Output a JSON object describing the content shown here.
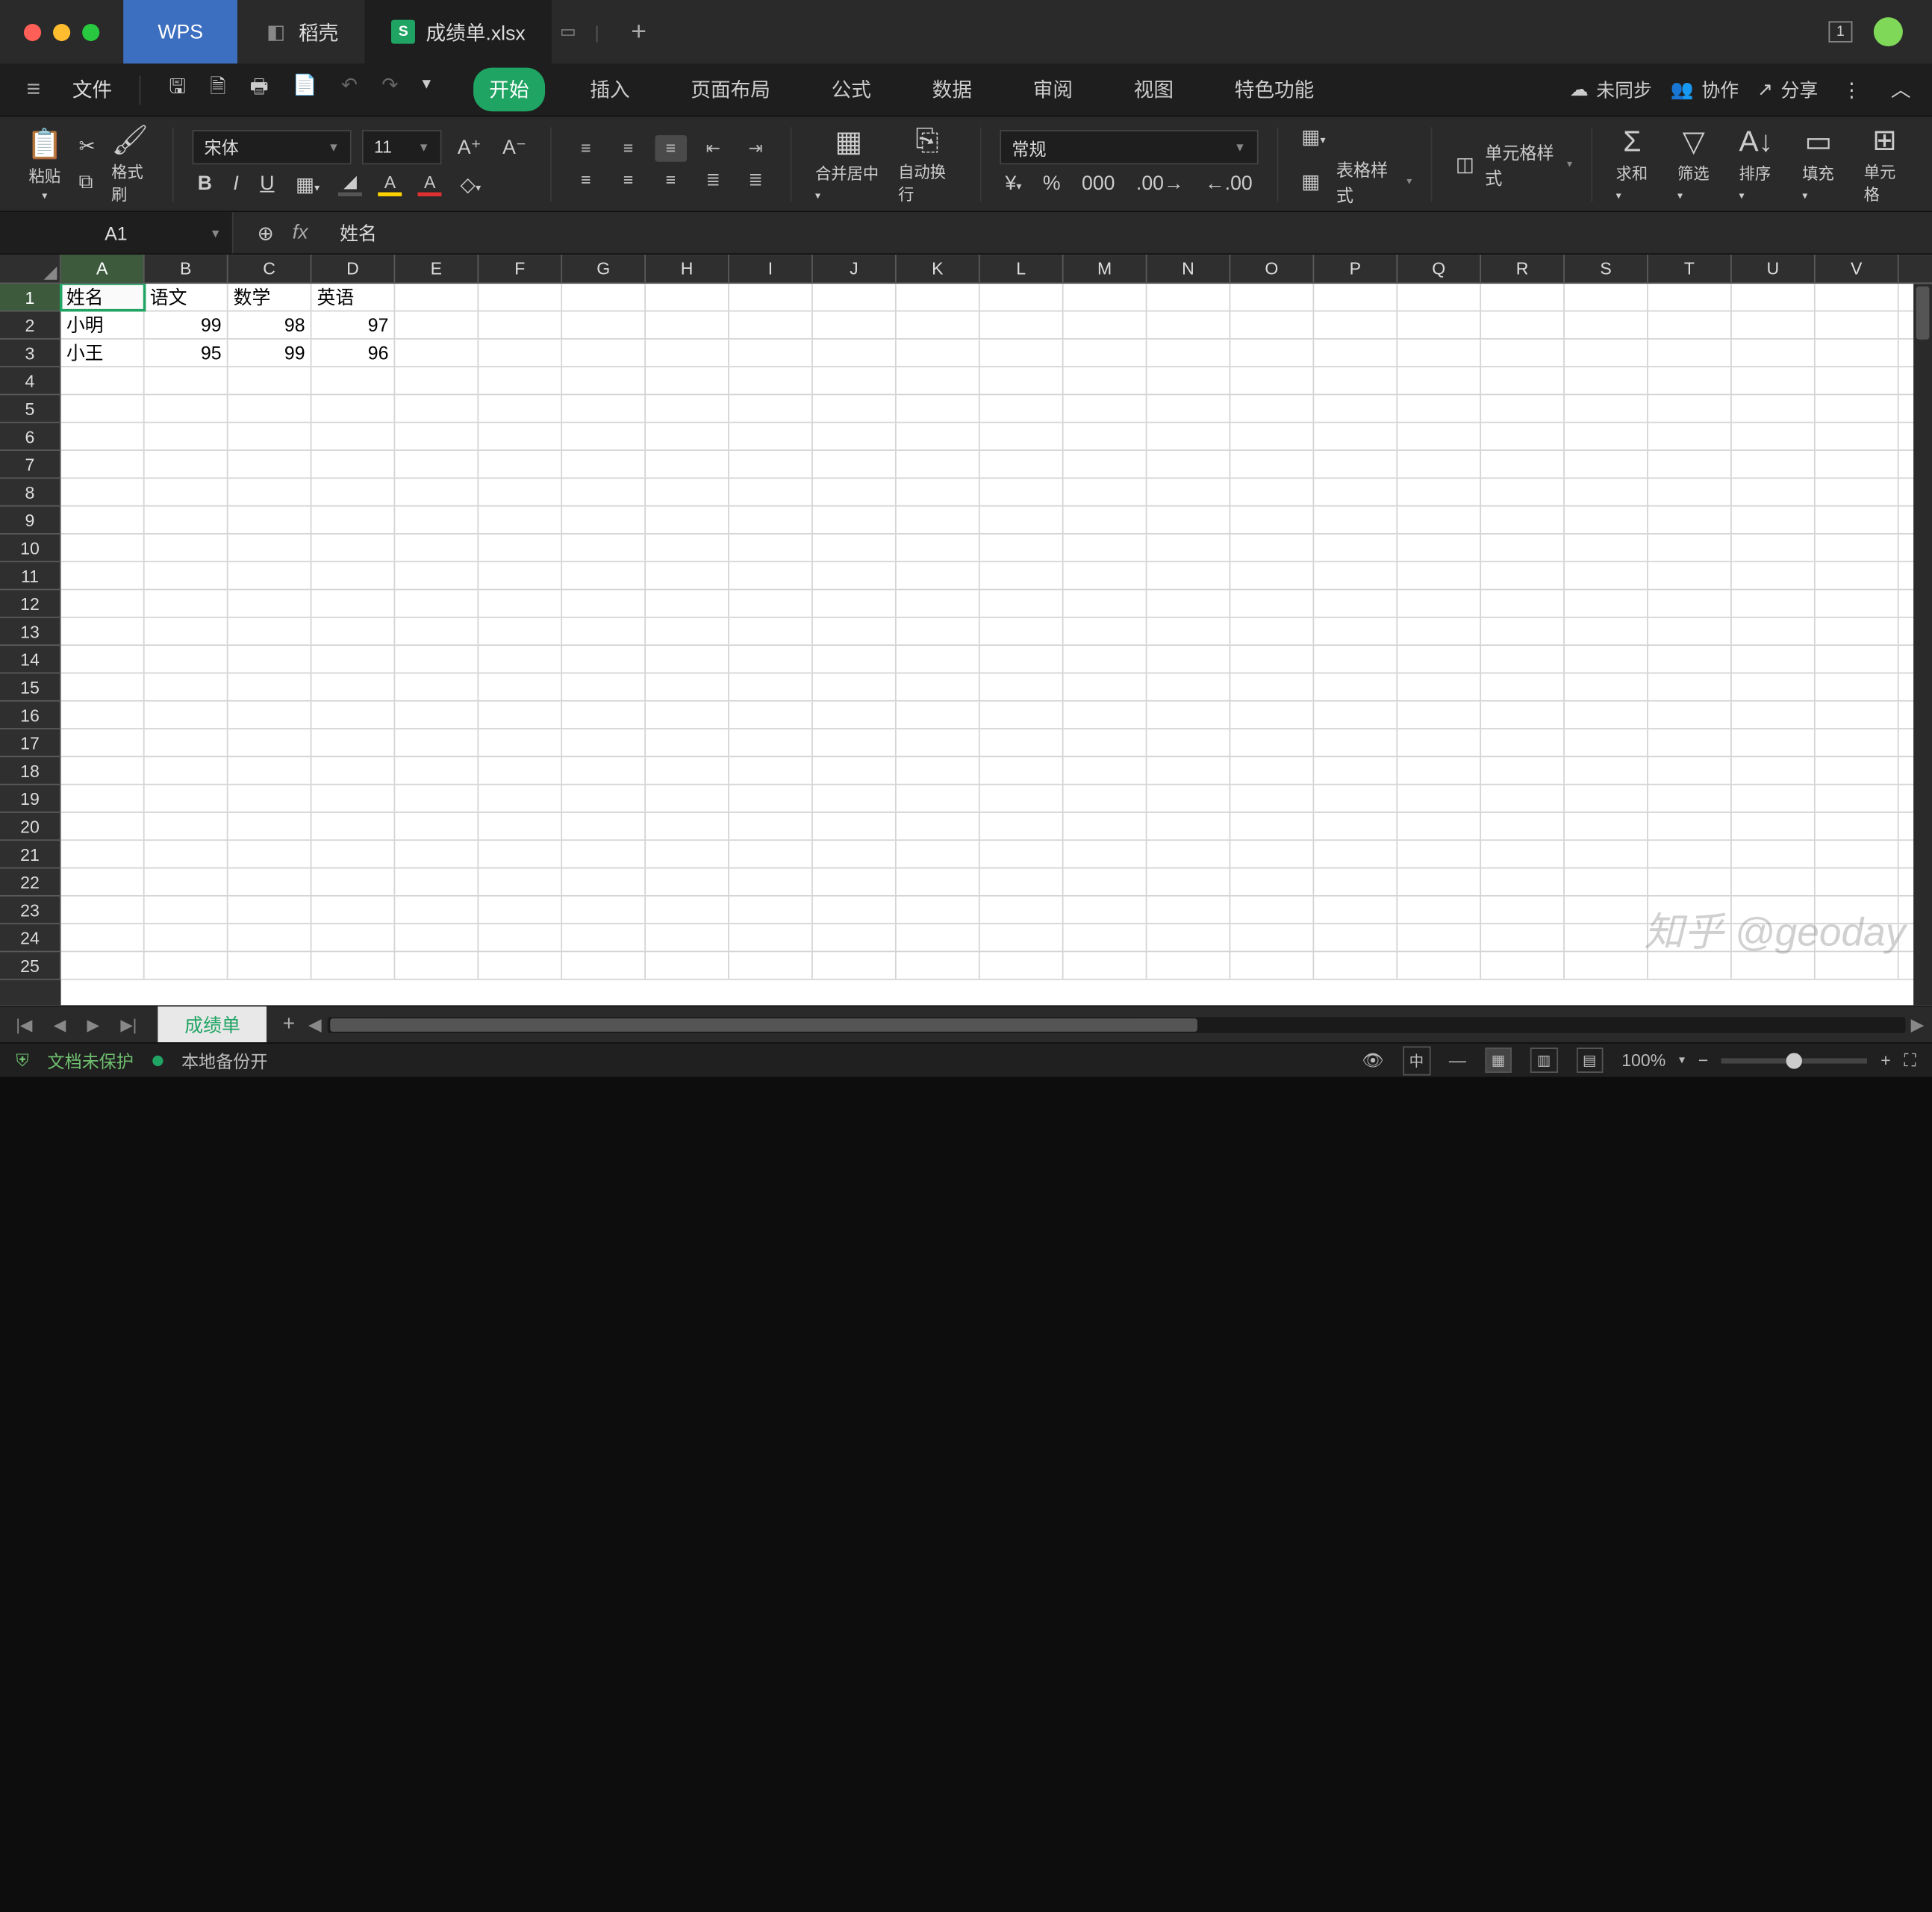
{
  "titlebar": {
    "wps_label": "WPS",
    "tab1_label": "稻壳",
    "tab2_label": "成绩单.xlsx",
    "window_badge": "1"
  },
  "menubar": {
    "file": "文件",
    "tabs": [
      "开始",
      "插入",
      "页面布局",
      "公式",
      "数据",
      "审阅",
      "视图",
      "特色功能"
    ],
    "active_tab_index": 0,
    "sync": "未同步",
    "collab": "协作",
    "share": "分享"
  },
  "ribbon": {
    "paste": "粘贴",
    "format_painter": "格式刷",
    "font_name": "宋体",
    "font_size": "11",
    "merge": "合并居中",
    "wrap": "自动换行",
    "number_format": "常规",
    "cell_style": "单元格样式",
    "table_style": "表格样式",
    "sum": "求和",
    "filter": "筛选",
    "sort": "排序",
    "fill": "填充",
    "cell": "单元格"
  },
  "formula_bar": {
    "cell_ref": "A1",
    "content": "姓名"
  },
  "grid": {
    "columns": [
      "A",
      "B",
      "C",
      "D",
      "E",
      "F",
      "G",
      "H",
      "I",
      "J",
      "K",
      "L",
      "M",
      "N",
      "O",
      "P",
      "Q",
      "R",
      "S",
      "T",
      "U",
      "V"
    ],
    "row_count": 25,
    "selected_cell": "A1",
    "data": [
      [
        "姓名",
        "语文",
        "数学",
        "英语"
      ],
      [
        "小明",
        "99",
        "98",
        "97"
      ],
      [
        "小王",
        "95",
        "99",
        "96"
      ]
    ]
  },
  "sheet": {
    "name": "成绩单"
  },
  "statusbar": {
    "protect": "文档未保护",
    "backup": "本地备份开",
    "zoom": "100%",
    "lang": "中"
  },
  "watermark": "知乎 @geoday"
}
